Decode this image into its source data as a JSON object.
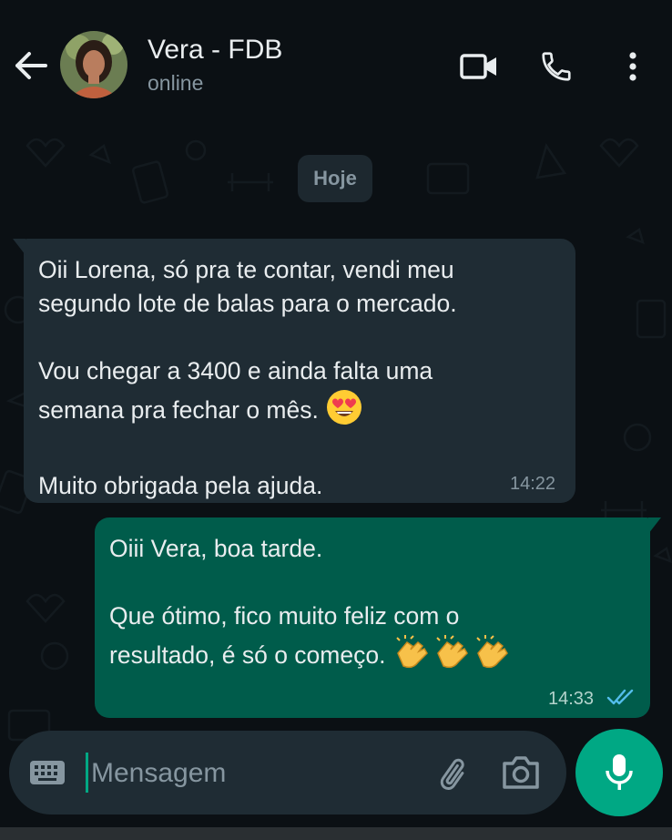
{
  "header": {
    "contact_name": "Vera - FDB",
    "status": "online"
  },
  "date_chip": "Hoje",
  "messages": [
    {
      "direction": "incoming",
      "lines": [
        "Oii Lorena, só pra te contar, vendi meu",
        "segundo lote de balas para o mercado.",
        "",
        "Vou chegar a 3400 e ainda falta uma",
        "semana pra fechar o mês.",
        "",
        "Muito obrigada pela ajuda."
      ],
      "emoji": "heart-eyes-emoji",
      "time": "14:22"
    },
    {
      "direction": "outgoing",
      "lines": [
        "Oiii Vera, boa tarde.",
        "",
        "Que ótimo, fico muito feliz com o",
        "resultado, é só o começo."
      ],
      "emoji": "clapping-hands-emoji",
      "time": "14:33",
      "read_status": "read"
    }
  ],
  "composer": {
    "placeholder": "Mensagem"
  },
  "icons": {
    "back": "back-arrow-icon",
    "video": "video-call-icon",
    "phone": "phone-call-icon",
    "menu": "more-vert-icon",
    "keyboard": "keyboard-icon",
    "attach": "paperclip-icon",
    "camera": "camera-icon",
    "mic": "microphone-icon"
  },
  "colors": {
    "incoming_bubble": "#1f2c34",
    "outgoing_bubble": "#005c4b",
    "accent": "#00a884",
    "read_ticks": "#53bdeb"
  }
}
